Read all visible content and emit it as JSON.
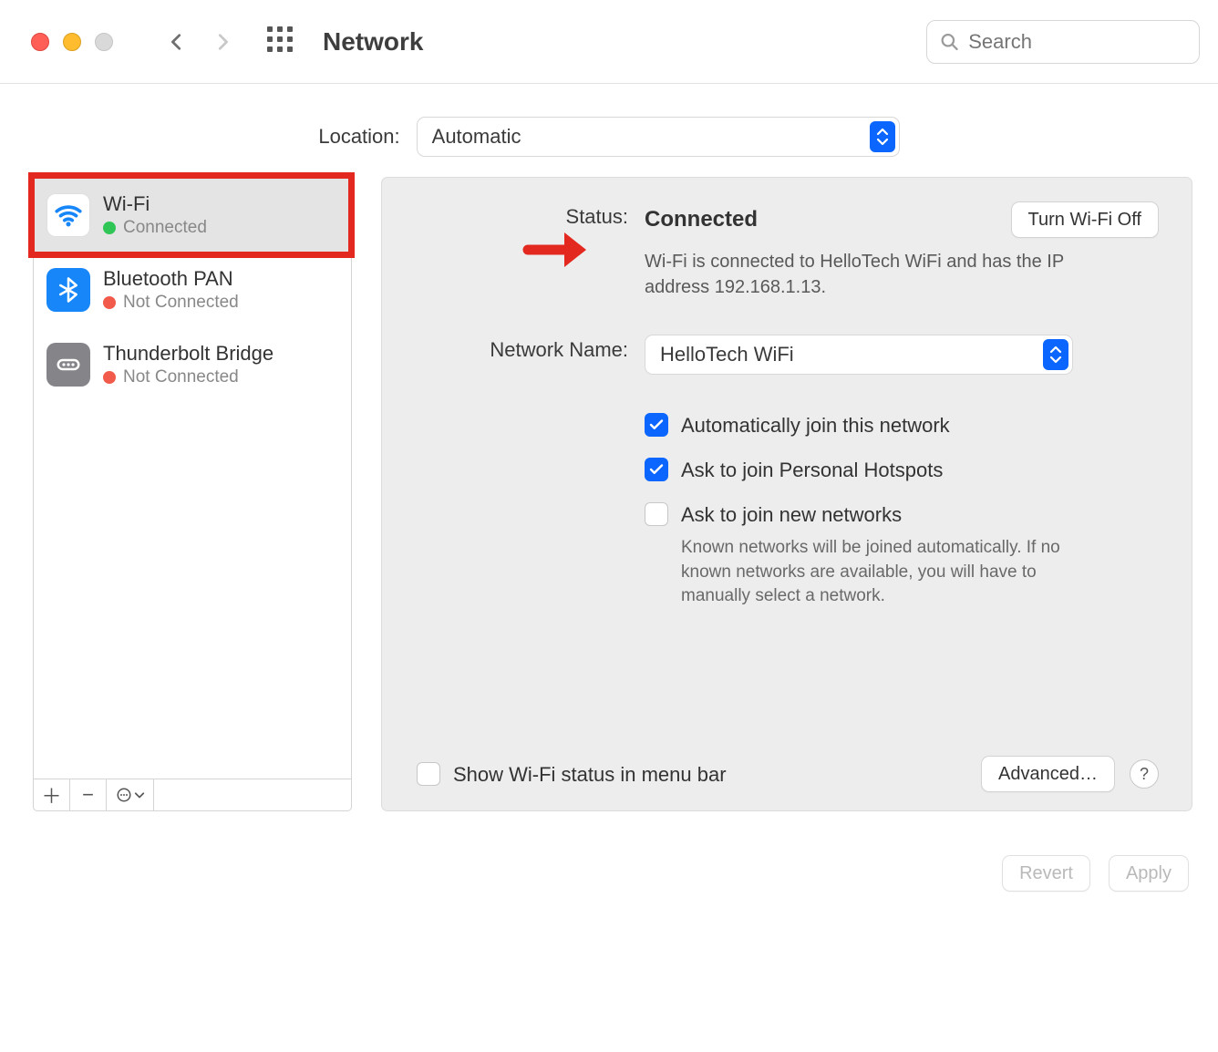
{
  "window": {
    "title": "Network",
    "search_placeholder": "Search"
  },
  "location": {
    "label": "Location:",
    "value": "Automatic"
  },
  "sidebar": {
    "items": [
      {
        "title": "Wi-Fi",
        "status": "Connected",
        "status_color": "green",
        "selected": true
      },
      {
        "title": "Bluetooth PAN",
        "status": "Not Connected",
        "status_color": "red",
        "selected": false
      },
      {
        "title": "Thunderbolt Bridge",
        "status": "Not Connected",
        "status_color": "red",
        "selected": false
      }
    ]
  },
  "detail": {
    "status_label": "Status:",
    "status_value": "Connected",
    "toggle_btn": "Turn Wi-Fi Off",
    "status_desc": "Wi-Fi is connected to HelloTech WiFi and has the IP address 192.168.1.13.",
    "network_name_label": "Network Name:",
    "network_name_value": "HelloTech WiFi",
    "opts": {
      "auto_join": {
        "label": "Automatically join this network",
        "checked": true
      },
      "ask_hotspot": {
        "label": "Ask to join Personal Hotspots",
        "checked": true
      },
      "ask_new": {
        "label": "Ask to join new networks",
        "checked": false,
        "hint": "Known networks will be joined automatically. If no known networks are available, you will have to manually select a network."
      }
    },
    "show_status": {
      "label": "Show Wi-Fi status in menu bar",
      "checked": false
    },
    "advanced_btn": "Advanced…",
    "help": "?"
  },
  "actions": {
    "revert": "Revert",
    "apply": "Apply"
  }
}
